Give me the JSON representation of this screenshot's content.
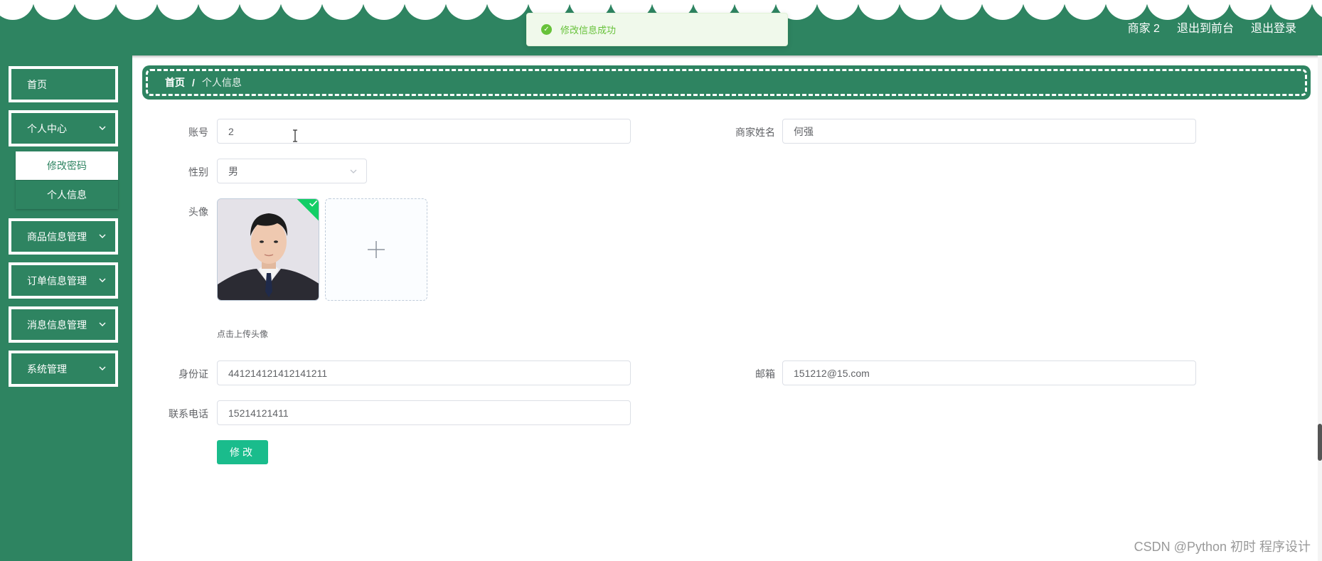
{
  "header": {
    "user_label": "商家 2",
    "to_frontend_label": "退出到前台",
    "logout_label": "退出登录",
    "color": "#2e8461"
  },
  "toast": {
    "message": "修改信息成功",
    "status": "success"
  },
  "sidebar": {
    "items": [
      {
        "label": "首页"
      },
      {
        "label": "个人中心",
        "expanded": true,
        "children": [
          {
            "label": "修改密码",
            "active": true
          },
          {
            "label": "个人信息",
            "active": false
          }
        ]
      },
      {
        "label": "商品信息管理"
      },
      {
        "label": "订单信息管理"
      },
      {
        "label": "消息信息管理"
      },
      {
        "label": "系统管理"
      }
    ]
  },
  "breadcrumb": {
    "home": "首页",
    "separator": "/",
    "current": "个人信息"
  },
  "form": {
    "account": {
      "label": "账号",
      "value": "2"
    },
    "merchant_name": {
      "label": "商家姓名",
      "value": "何强"
    },
    "gender": {
      "label": "性别",
      "value": "男"
    },
    "avatar": {
      "label": "头像",
      "hint": "点击上传头像"
    },
    "id_card": {
      "label": "身份证",
      "value": "441214121412141211"
    },
    "email": {
      "label": "邮箱",
      "value": "151212@15.com"
    },
    "phone": {
      "label": "联系电话",
      "value": "15214121411"
    },
    "submit_label": "修改"
  },
  "watermark": "CSDN @Python 初时 程序设计",
  "colors": {
    "primary": "#2e8461",
    "button": "#1abc8c",
    "success": "#67c23a"
  }
}
